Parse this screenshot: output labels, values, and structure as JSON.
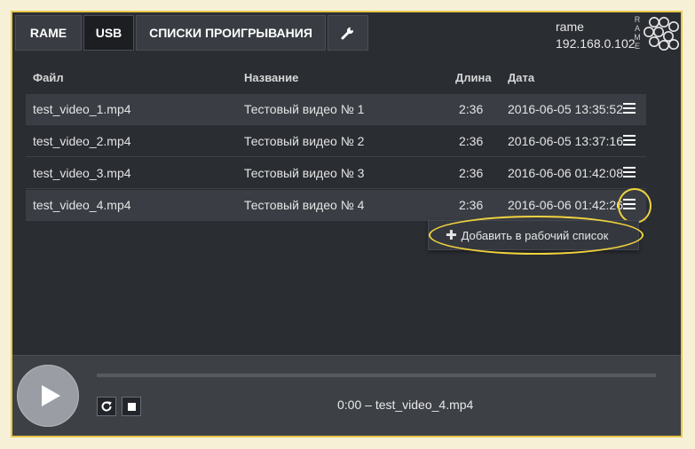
{
  "nav": {
    "tabs": [
      {
        "label": "RAME"
      },
      {
        "label": "USB"
      },
      {
        "label": "СПИСКИ ПРОИГРЫВАНИЯ"
      }
    ],
    "settings_icon": "wrench-icon"
  },
  "device": {
    "name": "rame",
    "ip": "192.168.0.102",
    "logo_letters": "RAME"
  },
  "table": {
    "headers": {
      "file": "Файл",
      "title": "Название",
      "length": "Длина",
      "date": "Дата"
    },
    "rows": [
      {
        "file": "test_video_1.mp4",
        "title": "Тестовый видео № 1",
        "length": "2:36",
        "date": "2016-06-05 13:35:52"
      },
      {
        "file": "test_video_2.mp4",
        "title": "Тестовый видео № 2",
        "length": "2:36",
        "date": "2016-06-05 13:37:16"
      },
      {
        "file": "test_video_3.mp4",
        "title": "Тестовый видео № 3",
        "length": "2:36",
        "date": "2016-06-06 01:42:08"
      },
      {
        "file": "test_video_4.mp4",
        "title": "Тестовый видео № 4",
        "length": "2:36",
        "date": "2016-06-06 01:42:26"
      }
    ]
  },
  "context_menu": {
    "add_label": "Добавить в рабочий список"
  },
  "player": {
    "now_playing": "0:00 – test_video_4.mp4",
    "progress": 0
  },
  "colors": {
    "highlight": "#f1d33f",
    "background": "#2a2d32"
  }
}
